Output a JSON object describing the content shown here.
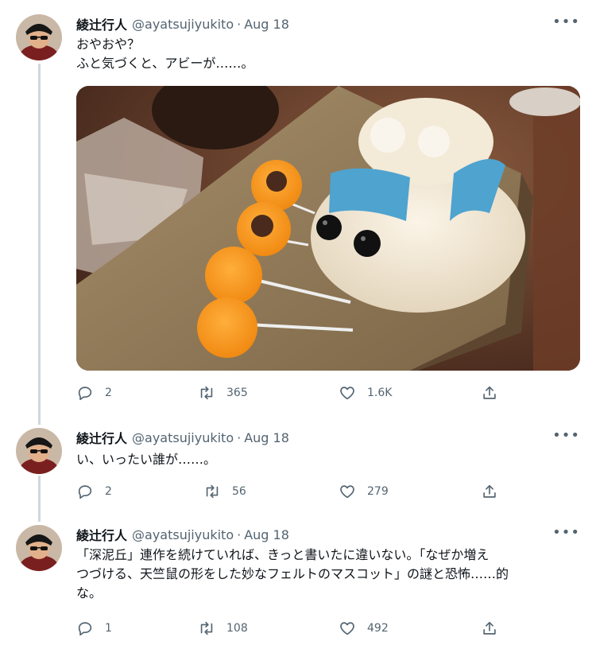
{
  "tweets": [
    {
      "name": "綾辻行人",
      "handle": "@ayatsujiyukito",
      "separator": "·",
      "date": "Aug 18",
      "more": "•••",
      "lines": [
        "おやおや？",
        "ふと気づくと、アビーが……。"
      ],
      "replies": "2",
      "retweets": "365",
      "likes": "1.6K",
      "has_photo": true
    },
    {
      "name": "綾辻行人",
      "handle": "@ayatsujiyukito",
      "separator": "·",
      "date": "Aug 18",
      "more": "•••",
      "lines": [
        "い、いったい誰が……。"
      ],
      "replies": "2",
      "retweets": "56",
      "likes": "279"
    },
    {
      "name": "綾辻行人",
      "handle": "@ayatsujiyukito",
      "separator": "·",
      "date": "Aug 18",
      "more": "•••",
      "lines": [
        "「深泥丘」連作を続けていれば、きっと書いたに違いない。「なぜか増え",
        "つづける、天竺鼠の形をした妙なフェルトのマスコット」の謎と恐怖……的",
        "な。"
      ],
      "replies": "1",
      "retweets": "108",
      "likes": "492"
    }
  ],
  "icons": {
    "reply": "reply-icon",
    "retweet": "retweet-icon",
    "like": "heart-icon",
    "share": "share-icon"
  },
  "colors": {
    "text": "#0f1419",
    "secondary": "#536471",
    "thread_line": "#cfd9de"
  }
}
